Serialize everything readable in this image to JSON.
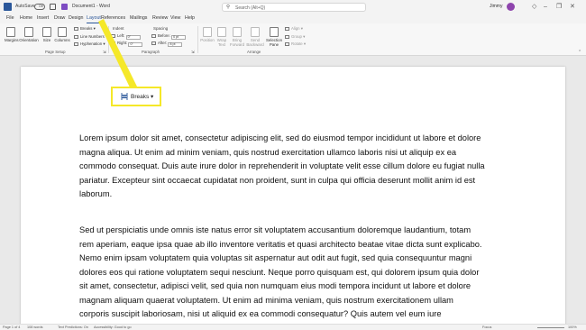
{
  "titlebar": {
    "autosave_label": "AutoSave",
    "autosave_state": "Off",
    "doc_title": "Document1 - Word",
    "search_placeholder": "Search (Alt+Q)",
    "user_name": "Jimmy",
    "minimize": "–",
    "restore": "❐",
    "close": "✕"
  },
  "menu": {
    "tabs": [
      "File",
      "Home",
      "Insert",
      "Draw",
      "Design",
      "Layout",
      "References",
      "Mailings",
      "Review",
      "View",
      "Help"
    ],
    "active_tab": "Layout",
    "comments_label": "Comments",
    "share_label": "Share"
  },
  "ribbon": {
    "page_setup": {
      "margins": "Margins",
      "orientation": "Orientation",
      "size": "Size",
      "columns": "Columns",
      "breaks": "Breaks",
      "line_numbers": "Line Numbers",
      "hyphenation": "Hyphenation",
      "group_label": "Page Setup"
    },
    "paragraph": {
      "indent_header": "Indent",
      "spacing_header": "Spacing",
      "left_label": "Left:",
      "left_value": "0\"",
      "right_label": "Right:",
      "right_value": "0\"",
      "before_label": "Before:",
      "before_value": "0 pt",
      "after_label": "After:",
      "after_value": "8 pt",
      "group_label": "Paragraph"
    },
    "arrange": {
      "position": "Position",
      "wrap_text": "Wrap Text",
      "bring_forward": "Bring Forward",
      "send_backward": "Send Backward",
      "selection_pane": "Selection Pane",
      "align": "Align",
      "group": "Group",
      "rotate": "Rotate",
      "group_label": "Arrange"
    }
  },
  "document": {
    "paragraph1": "Lorem ipsum dolor sit amet, consectetur adipiscing elit, sed do eiusmod tempor incididunt ut labore et dolore magna aliqua. Ut enim ad minim veniam, quis nostrud exercitation ullamco laboris nisi ut aliquip ex ea commodo consequat. Duis aute irure dolor in reprehenderit in voluptate velit esse cillum dolore eu fugiat nulla pariatur. Excepteur sint occaecat cupidatat non proident, sunt in culpa qui officia deserunt mollit anim id est laborum.",
    "paragraph2": "Sed ut perspiciatis unde omnis iste natus error sit voluptatem accusantium doloremque laudantium, totam rem aperiam, eaque ipsa quae ab illo inventore veritatis et quasi architecto beatae vitae dicta sunt explicabo. Nemo enim ipsam voluptatem quia voluptas sit aspernatur aut odit aut fugit, sed quia consequuntur magni dolores eos qui ratione voluptatem sequi nesciunt. Neque porro quisquam est, qui dolorem ipsum quia dolor sit amet, consectetur, adipisci velit, sed quia non numquam eius modi tempora incidunt ut labore et dolore magnam aliquam quaerat voluptatem. Ut enim ad minima veniam, quis nostrum exercitationem ullam corporis suscipit laboriosam, nisi ut aliquid ex ea commodi consequatur? Quis autem vel eum iure reprehenderit qui in ea voluptate velit esse quam nihil molestiae"
  },
  "statusbar": {
    "page": "Page 1 of 4",
    "words": "108 words",
    "text_predictions": "Text Predictions: On",
    "accessibility": "Accessibility: Good to go",
    "focus": "Focus",
    "zoom": "100%"
  },
  "callout": {
    "label": "Breaks",
    "icon": "page-break-icon",
    "highlight_color": "#f5e829"
  },
  "colors": {
    "word_blue": "#2b579a",
    "callout_yellow": "#f5e829"
  }
}
